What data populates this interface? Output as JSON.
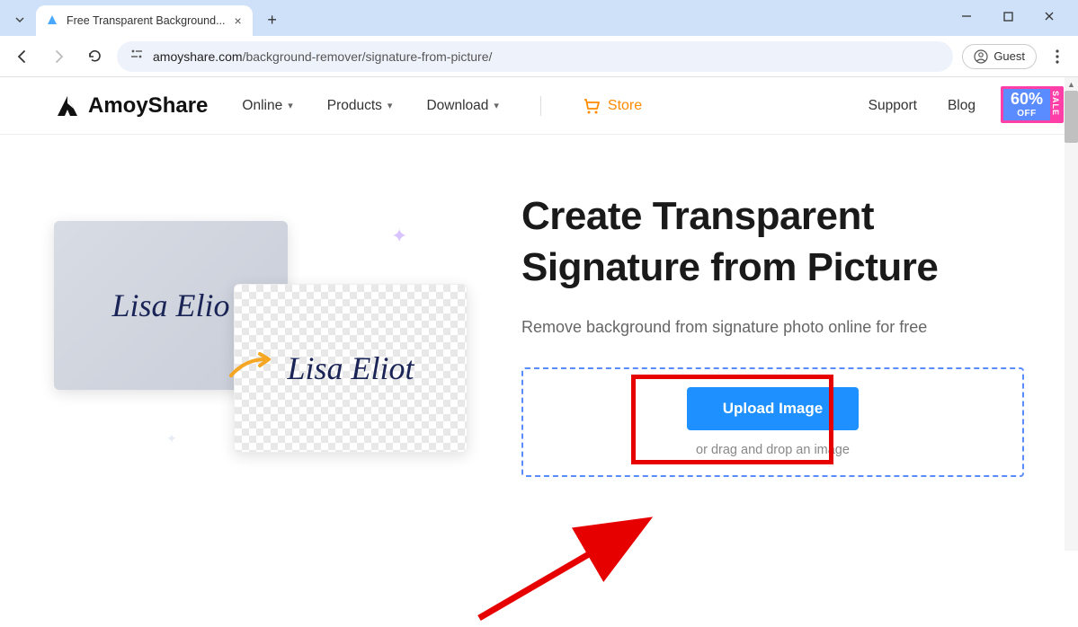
{
  "browser": {
    "tab_title": "Free Transparent Background...",
    "url_domain": "amoyshare.com",
    "url_path": "/background-remover/signature-from-picture/",
    "guest_label": "Guest"
  },
  "header": {
    "brand": "AmoyShare",
    "nav": {
      "online": "Online",
      "products": "Products",
      "download": "Download",
      "store": "Store",
      "support": "Support",
      "blog": "Blog"
    },
    "sale": {
      "percent": "60%",
      "off": "OFF",
      "side": "SALE"
    }
  },
  "hero": {
    "headline": "Create Transparent Signature from Picture",
    "subhead": "Remove background from signature photo online for free",
    "upload_button": "Upload Image",
    "upload_hint": "or drag and drop an image",
    "signature_sample_back": "Lisa Elio",
    "signature_sample_front": "Lisa Eliot"
  }
}
